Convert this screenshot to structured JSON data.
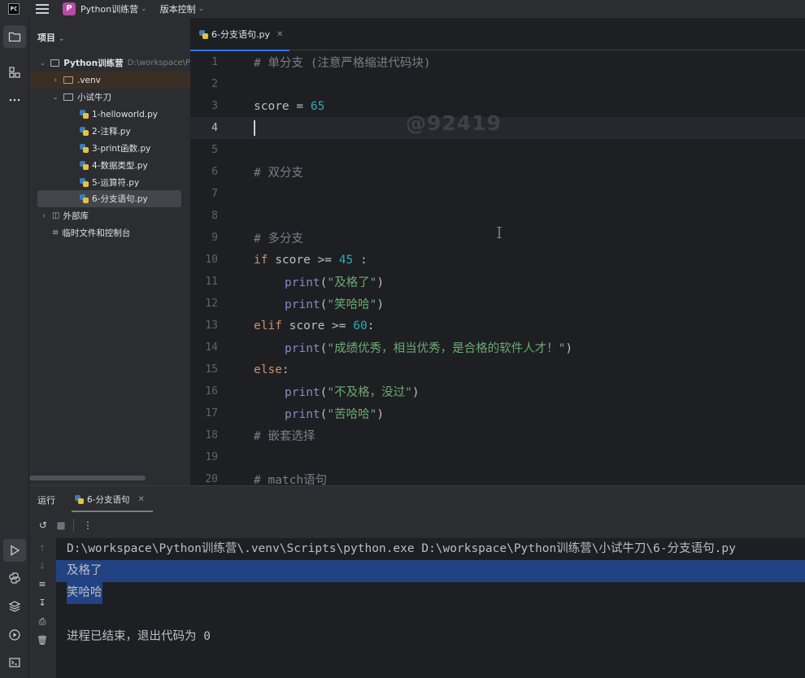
{
  "titlebar": {
    "app_logo": "PC",
    "project_badge": "P",
    "project_name": "Python训练营",
    "vcs_label": "版本控制"
  },
  "project_panel": {
    "title": "项目",
    "root_name": "Python训练营",
    "root_path": "D:\\workspace\\P",
    "venv": ".venv",
    "folder": "小试牛刀",
    "files": [
      "1-helloworld.py",
      "2-注释.py",
      "3-print函数.py",
      "4-数据类型.py",
      "5-运算符.py",
      "6-分支语句.py"
    ],
    "external_libs": "外部库",
    "scratches": "临时文件和控制台"
  },
  "editor": {
    "tab_label": "6-分支语句.py",
    "watermark": "@92419",
    "line_numbers": [
      "1",
      "2",
      "3",
      "4",
      "5",
      "6",
      "7",
      "8",
      "9",
      "10",
      "11",
      "12",
      "13",
      "14",
      "15",
      "16",
      "17",
      "18",
      "19",
      "20"
    ],
    "lines": {
      "l1": "# 单分支 (注意严格缩进代码块)",
      "l3_var": "score",
      "l3_op": " = ",
      "l3_num": "65",
      "l6": "# 双分支",
      "l9": "# 多分支",
      "l10_kw": "if",
      "l10_mid": " score >= ",
      "l10_num": "45",
      "l10_end": " :",
      "l11_fn": "print",
      "l11_str": "\"及格了\"",
      "l12_fn": "print",
      "l12_str": "\"笑哈哈\"",
      "l13_kw": "elif",
      "l13_mid": " score >= ",
      "l13_num": "60",
      "l13_end": ":",
      "l14_fn": "print",
      "l14_str": "\"成绩优秀，相当优秀，是合格的软件人才！\"",
      "l15_kw": "else",
      "l15_end": ":",
      "l16_fn": "print",
      "l16_str": "\"不及格，没过\"",
      "l17_fn": "print",
      "l17_str": "\"苦哈哈\"",
      "l18": "# 嵌套选择",
      "l20": "# match语句"
    }
  },
  "run_panel": {
    "title": "运行",
    "tab_label": "6-分支语句",
    "console": {
      "cmd": "D:\\workspace\\Python训练营\\.venv\\Scripts\\python.exe D:\\workspace\\Python训练营\\小试牛刀\\6-分支语句.py",
      "out1": "及格了",
      "out2": "笑哈哈",
      "exit": "进程已结束，退出代码为 0"
    }
  },
  "colors": {
    "accent": "#3574f0",
    "selection": "#214283",
    "keyword": "#cf8e6d",
    "number": "#2aacb8",
    "string": "#6aab73",
    "builtin": "#8888c6",
    "comment": "#7a7e85"
  }
}
